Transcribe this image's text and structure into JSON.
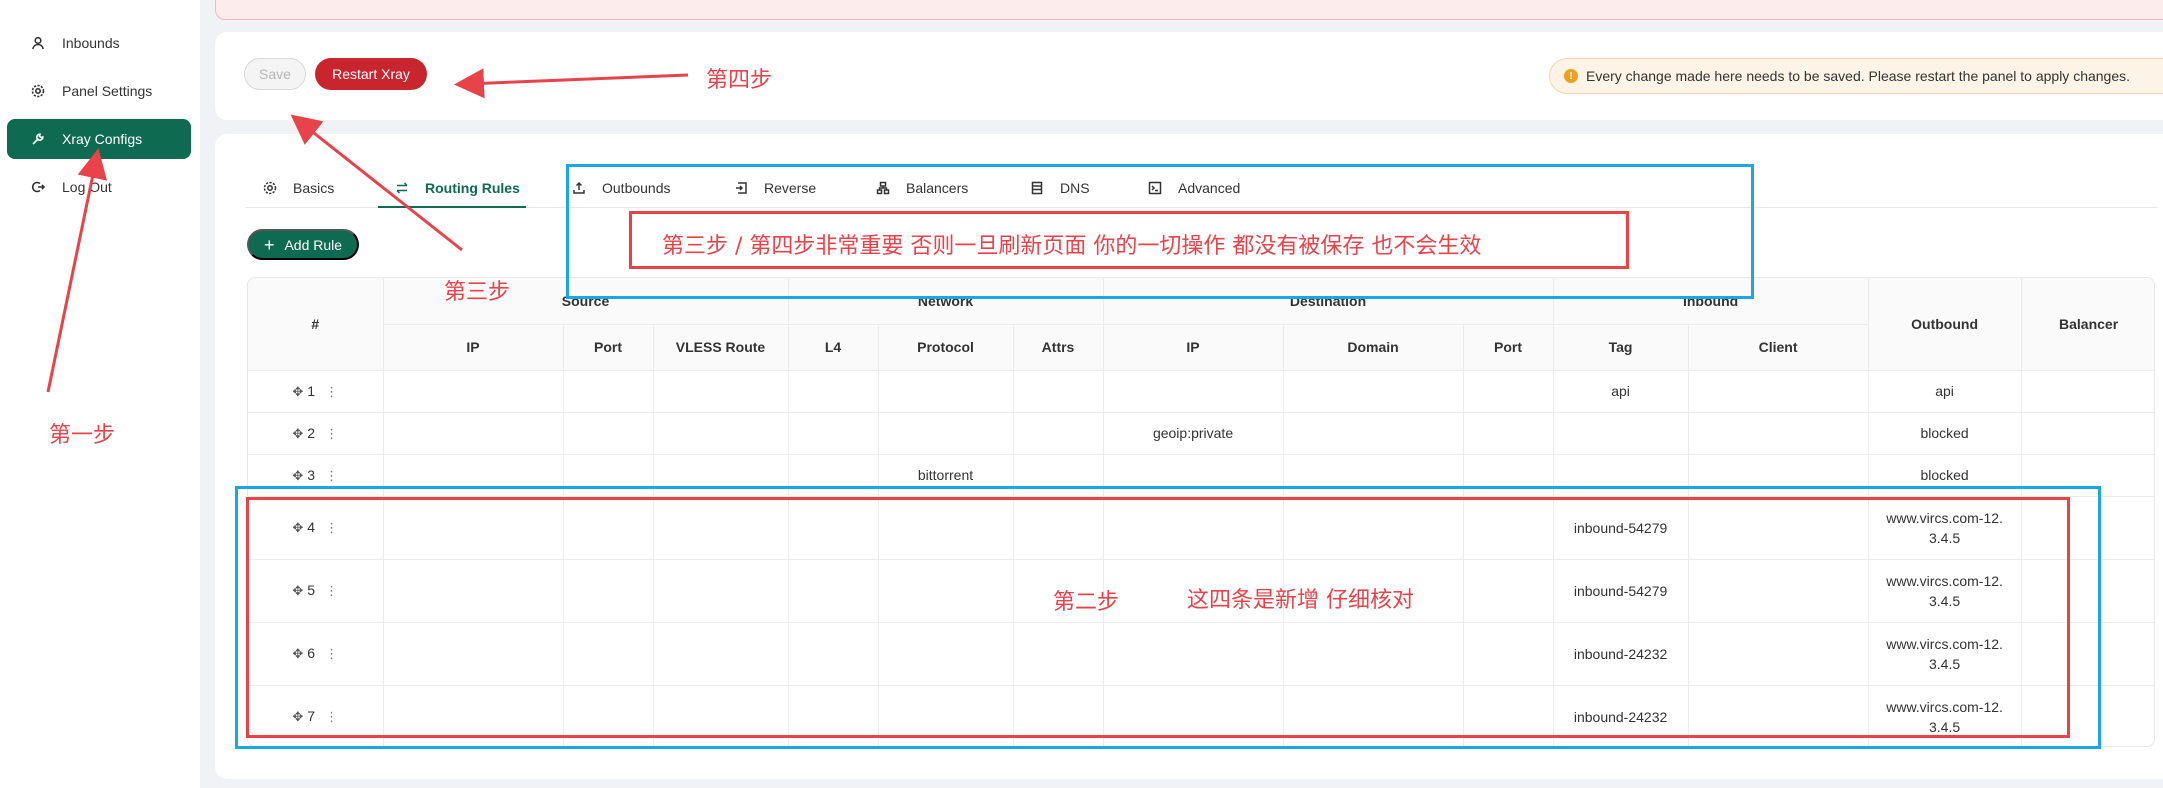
{
  "sidebar": {
    "items": [
      {
        "label": "Inbounds",
        "icon": "user-icon"
      },
      {
        "label": "Panel Settings",
        "icon": "gear-icon"
      },
      {
        "label": "Xray Configs",
        "icon": "wrench-icon"
      },
      {
        "label": "Log Out",
        "icon": "logout-icon"
      }
    ],
    "active": "Xray Configs"
  },
  "toolbar": {
    "save_label": "Save",
    "restart_label": "Restart Xray",
    "warning_icon": "!",
    "warning_text": "Every change made here needs to be saved. Please restart the panel to apply changes."
  },
  "tabs": [
    {
      "label": "Basics",
      "icon": "gear-icon"
    },
    {
      "label": "Routing Rules",
      "icon": "swap-icon"
    },
    {
      "label": "Outbounds",
      "icon": "upload-icon"
    },
    {
      "label": "Reverse",
      "icon": "import-icon"
    },
    {
      "label": "Balancers",
      "icon": "cluster-icon"
    },
    {
      "label": "DNS",
      "icon": "database-icon"
    },
    {
      "label": "Advanced",
      "icon": "code-icon"
    }
  ],
  "add_rule_label": "Add Rule",
  "table": {
    "group_headers": {
      "num": "#",
      "source": "Source",
      "network": "Network",
      "destination": "Destination",
      "inbound": "Inbound",
      "outbound": "Outbound",
      "balancer": "Balancer"
    },
    "sub_headers": {
      "ip": "IP",
      "port": "Port",
      "vless_route": "VLESS Route",
      "l4": "L4",
      "protocol": "Protocol",
      "attrs": "Attrs",
      "dest_ip": "IP",
      "domain": "Domain",
      "dest_port": "Port",
      "tag": "Tag",
      "client": "Client"
    },
    "rows": [
      {
        "num": "1",
        "protocol": "",
        "dest_ip": "",
        "tag": "api",
        "outbound": "api"
      },
      {
        "num": "2",
        "protocol": "",
        "dest_ip": "geoip:private",
        "tag": "",
        "outbound": "blocked"
      },
      {
        "num": "3",
        "protocol": "bittorrent",
        "dest_ip": "",
        "tag": "",
        "outbound": "blocked"
      },
      {
        "num": "4",
        "protocol": "",
        "dest_ip": "",
        "tag": "inbound-54279",
        "outbound": "www.vircs.com-12.3.4.5"
      },
      {
        "num": "5",
        "protocol": "",
        "dest_ip": "",
        "tag": "inbound-54279",
        "outbound": "www.vircs.com-12.3.4.5"
      },
      {
        "num": "6",
        "protocol": "",
        "dest_ip": "",
        "tag": "inbound-24232",
        "outbound": "www.vircs.com-12.3.4.5"
      },
      {
        "num": "7",
        "protocol": "",
        "dest_ip": "",
        "tag": "inbound-24232",
        "outbound": "www.vircs.com-12.3.4.5"
      }
    ]
  },
  "annotations": {
    "step1": "第一步",
    "step2": "第二步",
    "step2_note": "这四条是新增 仔细核对",
    "step3": "第三步",
    "step3_note": "第三步 / 第四步非常重要 否则一旦刷新页面 你的一切操作 都没有被保存 也不会生效",
    "step4": "第四步",
    "color_red": "#e8434b",
    "color_blue": "#19a7e8"
  }
}
